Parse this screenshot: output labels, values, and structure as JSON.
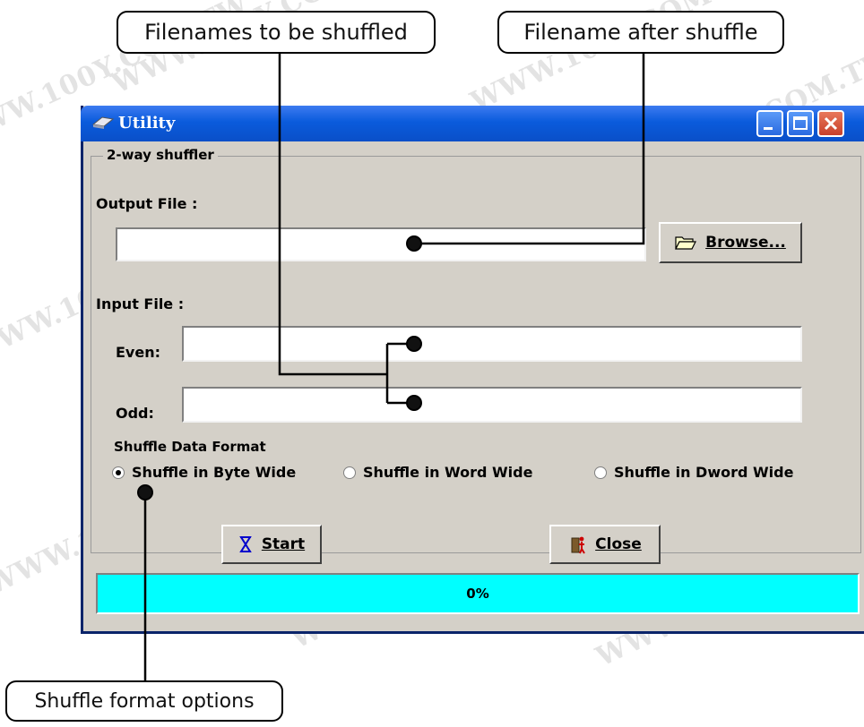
{
  "callouts": {
    "filenames_shuffled": "Filenames to be shuffled",
    "filename_after": "Filename after shuffle",
    "format_options": "Shuffle format options"
  },
  "watermark": "WWW.100Y.COM.TW",
  "window": {
    "title": "Utility",
    "group_title": "2-way shuffler",
    "output_label": "Output File :",
    "output_value": "",
    "browse_label": "Browse...",
    "input_label": "Input File :",
    "even_label": "Even:",
    "even_value": "",
    "odd_label": "Odd:",
    "odd_value": "",
    "format_title": "Shuffle Data Format",
    "options": [
      {
        "label": "Shuffle in Byte Wide",
        "selected": true
      },
      {
        "label": "Shuffle in Word Wide",
        "selected": false
      },
      {
        "label": "Shuffle in Dword Wide",
        "selected": false
      }
    ],
    "start_label": "Start",
    "close_label": "Close",
    "progress_text": "0%",
    "progress_value": 0.0
  },
  "colors": {
    "progress_fill": "#00ffff",
    "titlebar": "#0a5bdc"
  }
}
